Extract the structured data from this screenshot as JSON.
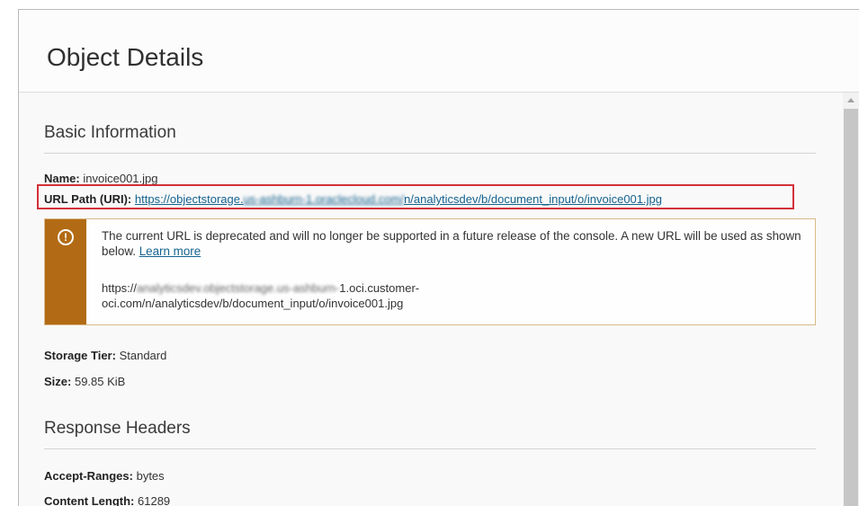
{
  "panel": {
    "title": "Object Details"
  },
  "basic_info": {
    "heading": "Basic Information",
    "name_label": "Name:",
    "name_value": "invoice001.jpg",
    "url_label": "URL Path (URI):",
    "url_prefix": "https://objectstorage.",
    "url_blurred": "us-ashburn-1.oraclecloud.com/",
    "url_suffix": "n/analyticsdev/b/document_input/o/invoice001.jpg"
  },
  "notice": {
    "icon": "exclamation-circle-icon",
    "message": "The current URL is deprecated and will no longer be supported in a future release of the console. A new URL will be used as shown below.",
    "learn_more": "Learn more",
    "new_url_prefix": "https://",
    "new_url_blurred": "analyticsdev.objectstorage.us-ashburn-",
    "new_url_suffix": "1.oci.customer-",
    "new_url_line2": "oci.com/n/analyticsdev/b/document_input/o/invoice001.jpg"
  },
  "storage": {
    "tier_label": "Storage Tier:",
    "tier_value": "Standard",
    "size_label": "Size:",
    "size_value": "59.85 KiB"
  },
  "response_headers": {
    "heading": "Response Headers",
    "accept_ranges_label": "Accept-Ranges:",
    "accept_ranges_value": "bytes",
    "content_length_label": "Content Length:",
    "content_length_value": "61289"
  },
  "colors": {
    "link": "#15638f",
    "warning_stripe": "#b26b14",
    "highlight_border": "#d2313a"
  }
}
